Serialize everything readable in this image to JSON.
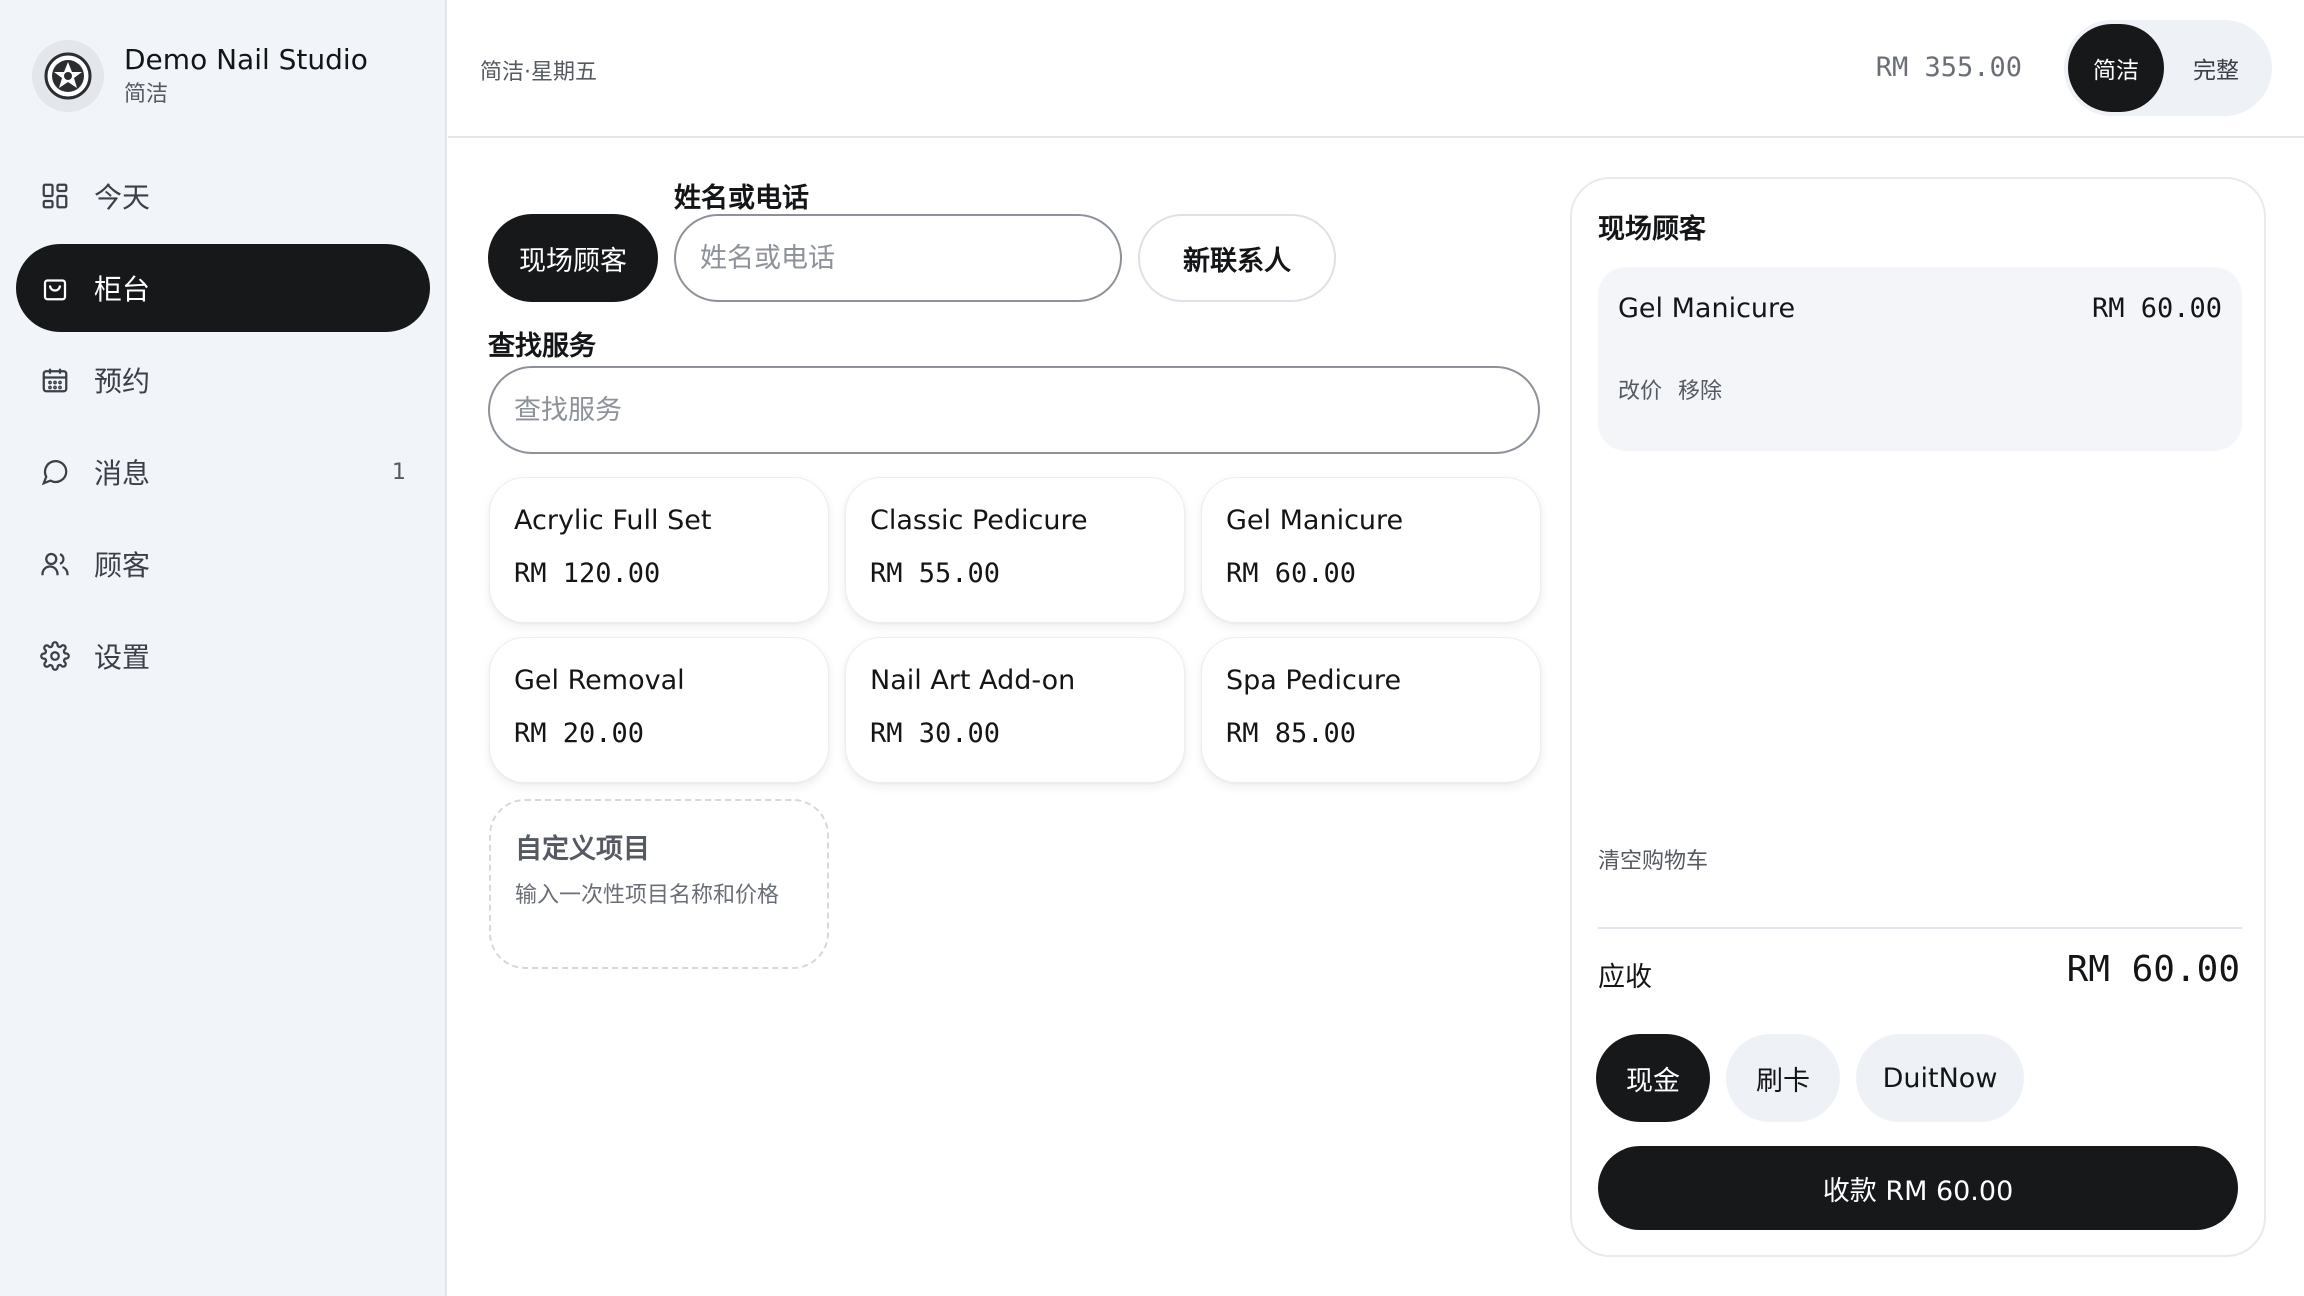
{
  "sidebar": {
    "brand_name": "Demo Nail Studio",
    "brand_sub": "简洁",
    "items": [
      {
        "label": "今天",
        "icon": "grid-icon"
      },
      {
        "label": "柜台",
        "icon": "shopping-bag-icon",
        "active": true
      },
      {
        "label": "预约",
        "icon": "calendar-icon"
      },
      {
        "label": "消息",
        "icon": "chat-bubble-icon",
        "badge": "1"
      },
      {
        "label": "顾客",
        "icon": "users-icon"
      },
      {
        "label": "设置",
        "icon": "gear-icon"
      }
    ]
  },
  "topbar": {
    "title": "简洁·星期五",
    "total": "RM 355.00",
    "mode_options": [
      "简洁",
      "完整"
    ],
    "mode_selected": "简洁"
  },
  "customer": {
    "walkin_label": "现场顾客",
    "search_label": "姓名或电话",
    "search_placeholder": "姓名或电话",
    "new_contact_label": "新联系人"
  },
  "services": {
    "search_label": "查找服务",
    "search_placeholder": "查找服务",
    "items": [
      {
        "name": "Acrylic Full Set",
        "price": "RM 120.00"
      },
      {
        "name": "Classic Pedicure",
        "price": "RM 55.00"
      },
      {
        "name": "Gel Manicure",
        "price": "RM 60.00"
      },
      {
        "name": "Gel Removal",
        "price": "RM 20.00"
      },
      {
        "name": "Nail Art Add-on",
        "price": "RM 30.00"
      },
      {
        "name": "Spa Pedicure",
        "price": "RM 85.00"
      }
    ],
    "custom_title": "自定义项目",
    "custom_desc": "输入一次性项目名称和价格"
  },
  "cart": {
    "title": "现场顾客",
    "items": [
      {
        "name": "Gel Manicure",
        "price": "RM 60.00",
        "edit_label": "改价",
        "remove_label": "移除"
      }
    ],
    "clear_label": "清空购物车",
    "due_label": "应收",
    "due_amount": "RM 60.00",
    "payment_methods": [
      "现金",
      "刷卡",
      "DuitNow"
    ],
    "payment_selected": "现金",
    "checkout_label": "收款 RM 60.00"
  },
  "colors": {
    "primary": "#17181a",
    "sidebar_bg": "#f1f4f9",
    "muted_text": "#555a62",
    "chip_bg": "#eef1f6"
  }
}
